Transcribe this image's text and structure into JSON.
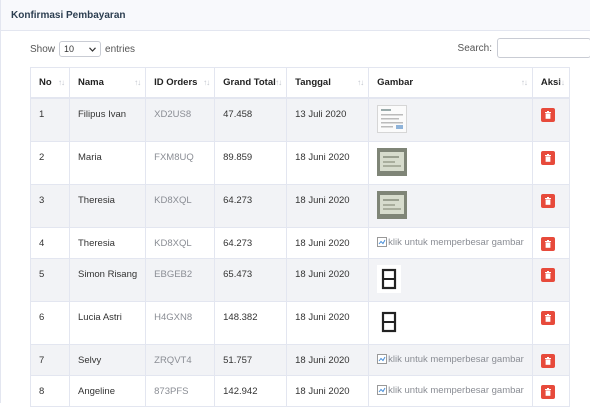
{
  "header": {
    "title": "Konfirmasi Pembayaran"
  },
  "controls": {
    "show_label": "Show",
    "entries_value": "10",
    "entries_label": "entries",
    "search_label": "Search:",
    "search_value": ""
  },
  "columns": [
    "No",
    "Nama",
    "ID Orders",
    "Grand Total",
    "Tanggal",
    "Gambar",
    "Aksi"
  ],
  "broken_image_text": "klik untuk memperbesar gambar",
  "rows": [
    {
      "no": "1",
      "nama": "Filipus Ivan",
      "id": "XD2US8",
      "total": "47.458",
      "tanggal": "13 Juli 2020",
      "gambar": "document"
    },
    {
      "no": "2",
      "nama": "Maria",
      "id": "FXM8UQ",
      "total": "89.859",
      "tanggal": "18 Juni 2020",
      "gambar": "receipt-photo"
    },
    {
      "no": "3",
      "nama": "Theresia",
      "id": "KD8XQL",
      "total": "64.273",
      "tanggal": "18 Juni 2020",
      "gambar": "receipt-photo"
    },
    {
      "no": "4",
      "nama": "Theresia",
      "id": "KD8XQL",
      "total": "64.273",
      "tanggal": "18 Juni 2020",
      "gambar": "broken"
    },
    {
      "no": "5",
      "nama": "Simon Risang",
      "id": "EBGEB2",
      "total": "65.473",
      "tanggal": "18 Juni 2020",
      "gambar": "icon"
    },
    {
      "no": "6",
      "nama": "Lucia Astri",
      "id": "H4GXN8",
      "total": "148.382",
      "tanggal": "18 Juni 2020",
      "gambar": "icon"
    },
    {
      "no": "7",
      "nama": "Selvy",
      "id": "ZRQVT4",
      "total": "51.757",
      "tanggal": "18 Juni 2020",
      "gambar": "broken"
    },
    {
      "no": "8",
      "nama": "Angeline",
      "id": "873PFS",
      "total": "142.942",
      "tanggal": "18 Juni 2020",
      "gambar": "broken"
    }
  ]
}
